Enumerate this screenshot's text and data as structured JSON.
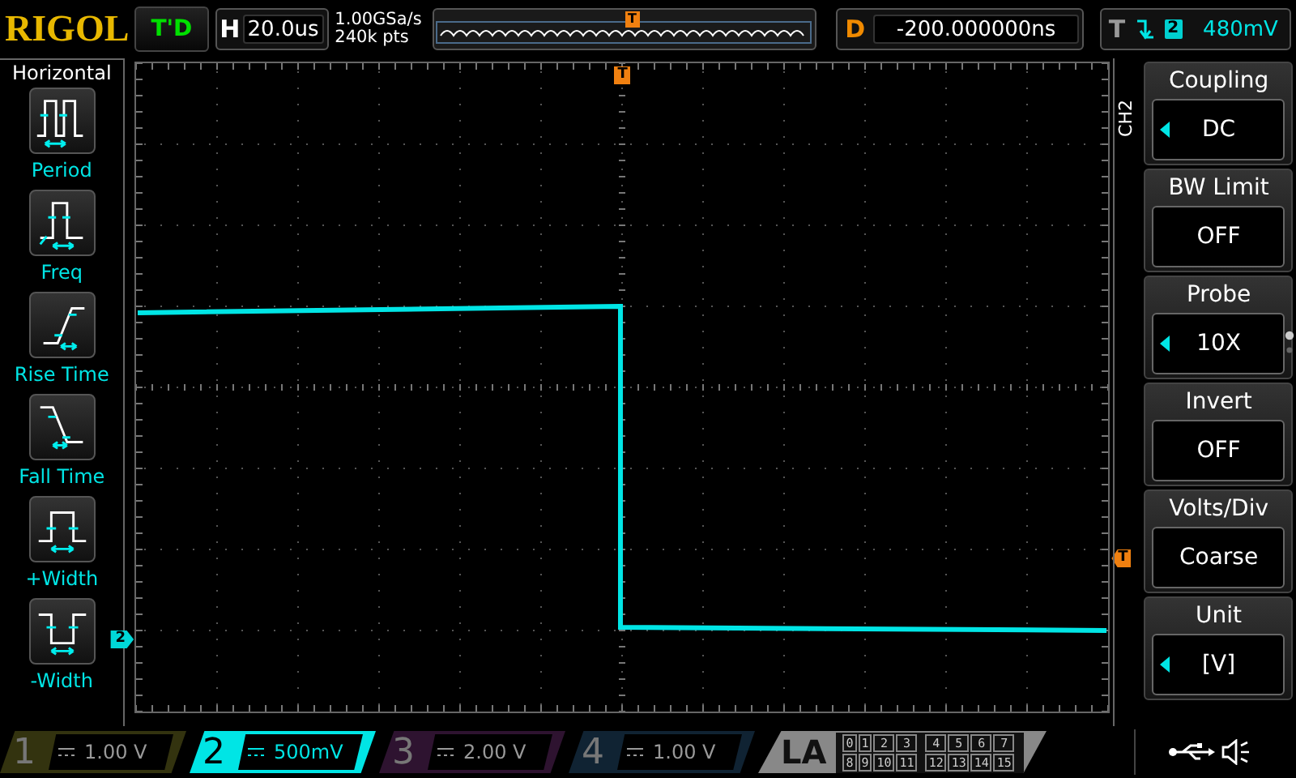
{
  "header": {
    "logo": "RIGOL",
    "run_status": "T'D",
    "timebase": {
      "label": "H",
      "value": "20.0us"
    },
    "sample_rate": "1.00GSa/s",
    "memory_depth": "240k pts",
    "trigger_position_marker": "T",
    "delay": {
      "label": "D",
      "value": "-200.000000ns"
    },
    "trigger": {
      "label": "T",
      "source": "2",
      "level": "480mV"
    }
  },
  "left_menu": {
    "title": "Horizontal",
    "items": [
      {
        "label": "Period",
        "kind": "period"
      },
      {
        "label": "Freq",
        "kind": "freq"
      },
      {
        "label": "Rise Time",
        "kind": "rise"
      },
      {
        "label": "Fall Time",
        "kind": "fall"
      },
      {
        "label": "+Width",
        "kind": "pwidth"
      },
      {
        "label": "-Width",
        "kind": "nwidth"
      }
    ]
  },
  "display": {
    "trigger_marker": "T",
    "trigger_level_marker": "T",
    "channel_marker": "2"
  },
  "right_menu": {
    "channel": "CH2",
    "items": [
      {
        "title": "Coupling",
        "value": "DC",
        "adjustable": true
      },
      {
        "title": "BW Limit",
        "value": "OFF",
        "adjustable": false
      },
      {
        "title": "Probe",
        "value": "10X",
        "adjustable": true
      },
      {
        "title": "Invert",
        "value": "OFF",
        "adjustable": false
      },
      {
        "title": "Volts/Div",
        "value": "Coarse",
        "adjustable": false
      },
      {
        "title": "Unit",
        "value": "[V]",
        "adjustable": true
      }
    ]
  },
  "channels": [
    {
      "number": "1",
      "scale": "1.00 V",
      "active": false,
      "color": "#33330f"
    },
    {
      "number": "2",
      "scale": "500mV",
      "active": true,
      "color": "#00e5e5"
    },
    {
      "number": "3",
      "scale": "2.00 V",
      "active": false,
      "color": "#2e1330"
    },
    {
      "number": "4",
      "scale": "1.00 V",
      "active": false,
      "color": "#102333"
    }
  ],
  "logic": {
    "label": "LA",
    "bits": [
      "0",
      "1",
      "2",
      "3",
      "4",
      "5",
      "6",
      "7",
      "8",
      "9",
      "10",
      "11",
      "12",
      "13",
      "14",
      "15"
    ]
  }
}
